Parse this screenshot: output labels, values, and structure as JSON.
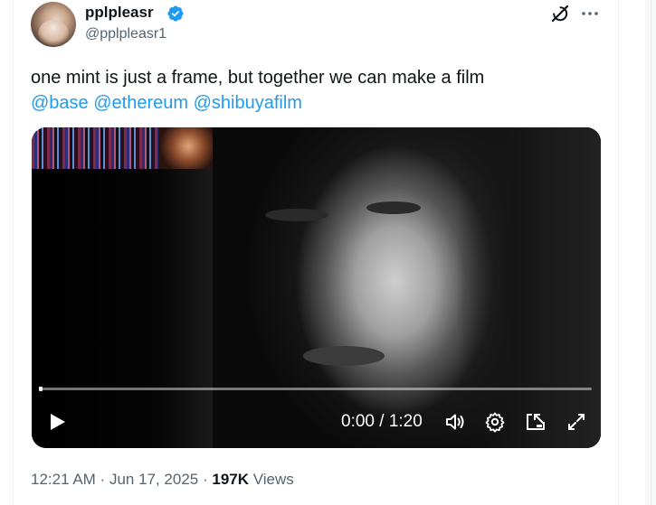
{
  "author": {
    "display_name": "pplpleasr",
    "handle": "@pplpleasr1",
    "verified": true
  },
  "tweet": {
    "text": "one mint is just a frame, but together we can make a film",
    "mentions": [
      "@base",
      "@ethereum",
      "@shibuyafilm"
    ]
  },
  "video": {
    "current_time": "0:00",
    "separator": " / ",
    "duration": "1:20",
    "progress": 0
  },
  "meta": {
    "time": "12:21 AM",
    "dot1": " · ",
    "date": "Jun 17, 2025",
    "dot2": " · ",
    "views_count": "197K",
    "views_label": " Views"
  },
  "colors": {
    "accent": "#1d9bf0",
    "text": "#0f1419",
    "muted": "#536471"
  },
  "icons": {
    "verified": "verified-badge-icon",
    "grok": "grok-icon",
    "more": "more-icon",
    "play": "play-icon",
    "volume": "volume-icon",
    "settings": "settings-icon",
    "pip": "picture-in-picture-icon",
    "fullscreen": "fullscreen-icon"
  }
}
